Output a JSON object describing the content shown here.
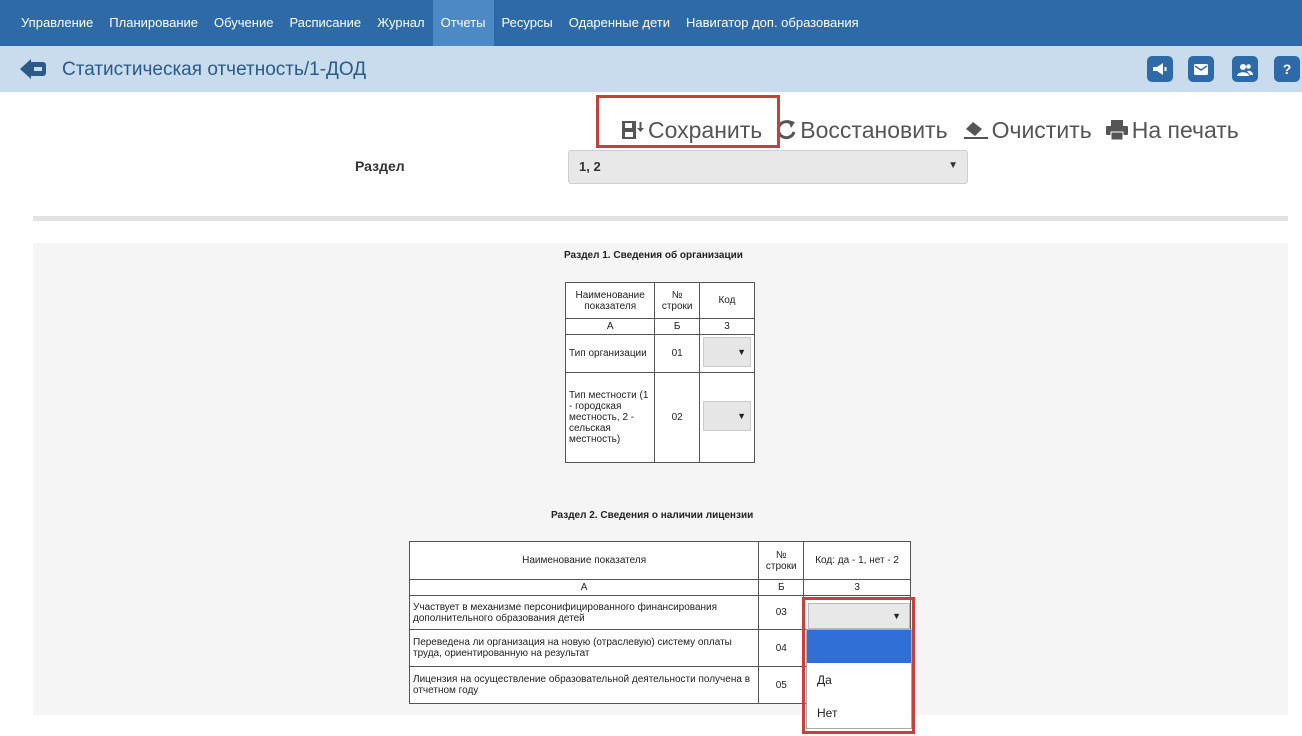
{
  "nav": {
    "items": [
      "Управление",
      "Планирование",
      "Обучение",
      "Расписание",
      "Журнал",
      "Отчеты",
      "Ресурсы",
      "Одаренные дети",
      "Навигатор доп. образования"
    ],
    "active": "Отчеты"
  },
  "header": {
    "title": "Статистическая отчетность/1-ДОД",
    "help_label": "?"
  },
  "toolbar": {
    "save_label": "Сохранить",
    "restore_label": "Восстановить",
    "clear_label": "Очистить",
    "print_label": "На печать"
  },
  "filter": {
    "label": "Раздел",
    "value": "1, 2",
    "arrow": "▼"
  },
  "section1": {
    "title": "Раздел 1. Сведения об организации",
    "headers": [
      "Наименование показателя",
      "№ строки",
      "Код"
    ],
    "letters": [
      "А",
      "Б",
      "3"
    ],
    "rows": [
      {
        "name": "Тип организации",
        "num": "01"
      },
      {
        "name": "Тип местности (1 - городская местность, 2 - сельская местность)",
        "num": "02"
      }
    ]
  },
  "section2": {
    "title": "Раздел 2. Сведения о наличии лицензии",
    "headers": [
      "Наименование показателя",
      "№ строки",
      "Код: да - 1, нет - 2"
    ],
    "letters": [
      "А",
      "Б",
      "3"
    ],
    "rows": [
      {
        "name": "Участвует в механизме персонифицированного финансирования дополнительного образования детей",
        "num": "03"
      },
      {
        "name": "Переведена ли организация на новую (отраслевую) систему оплаты труда, ориентированную на результат",
        "num": "04"
      },
      {
        "name": "Лицензия на осуществление образовательной деятельности получена в отчетном году",
        "num": "05"
      }
    ]
  },
  "dropdown": {
    "options": [
      "",
      "Да",
      "Нет"
    ],
    "arrow": "▼"
  },
  "colors": {
    "nav_bg": "#2e6aa8",
    "titlebar_bg": "#c9dcee",
    "highlight": "#c9403a",
    "selected_option": "#2f6fd6"
  }
}
